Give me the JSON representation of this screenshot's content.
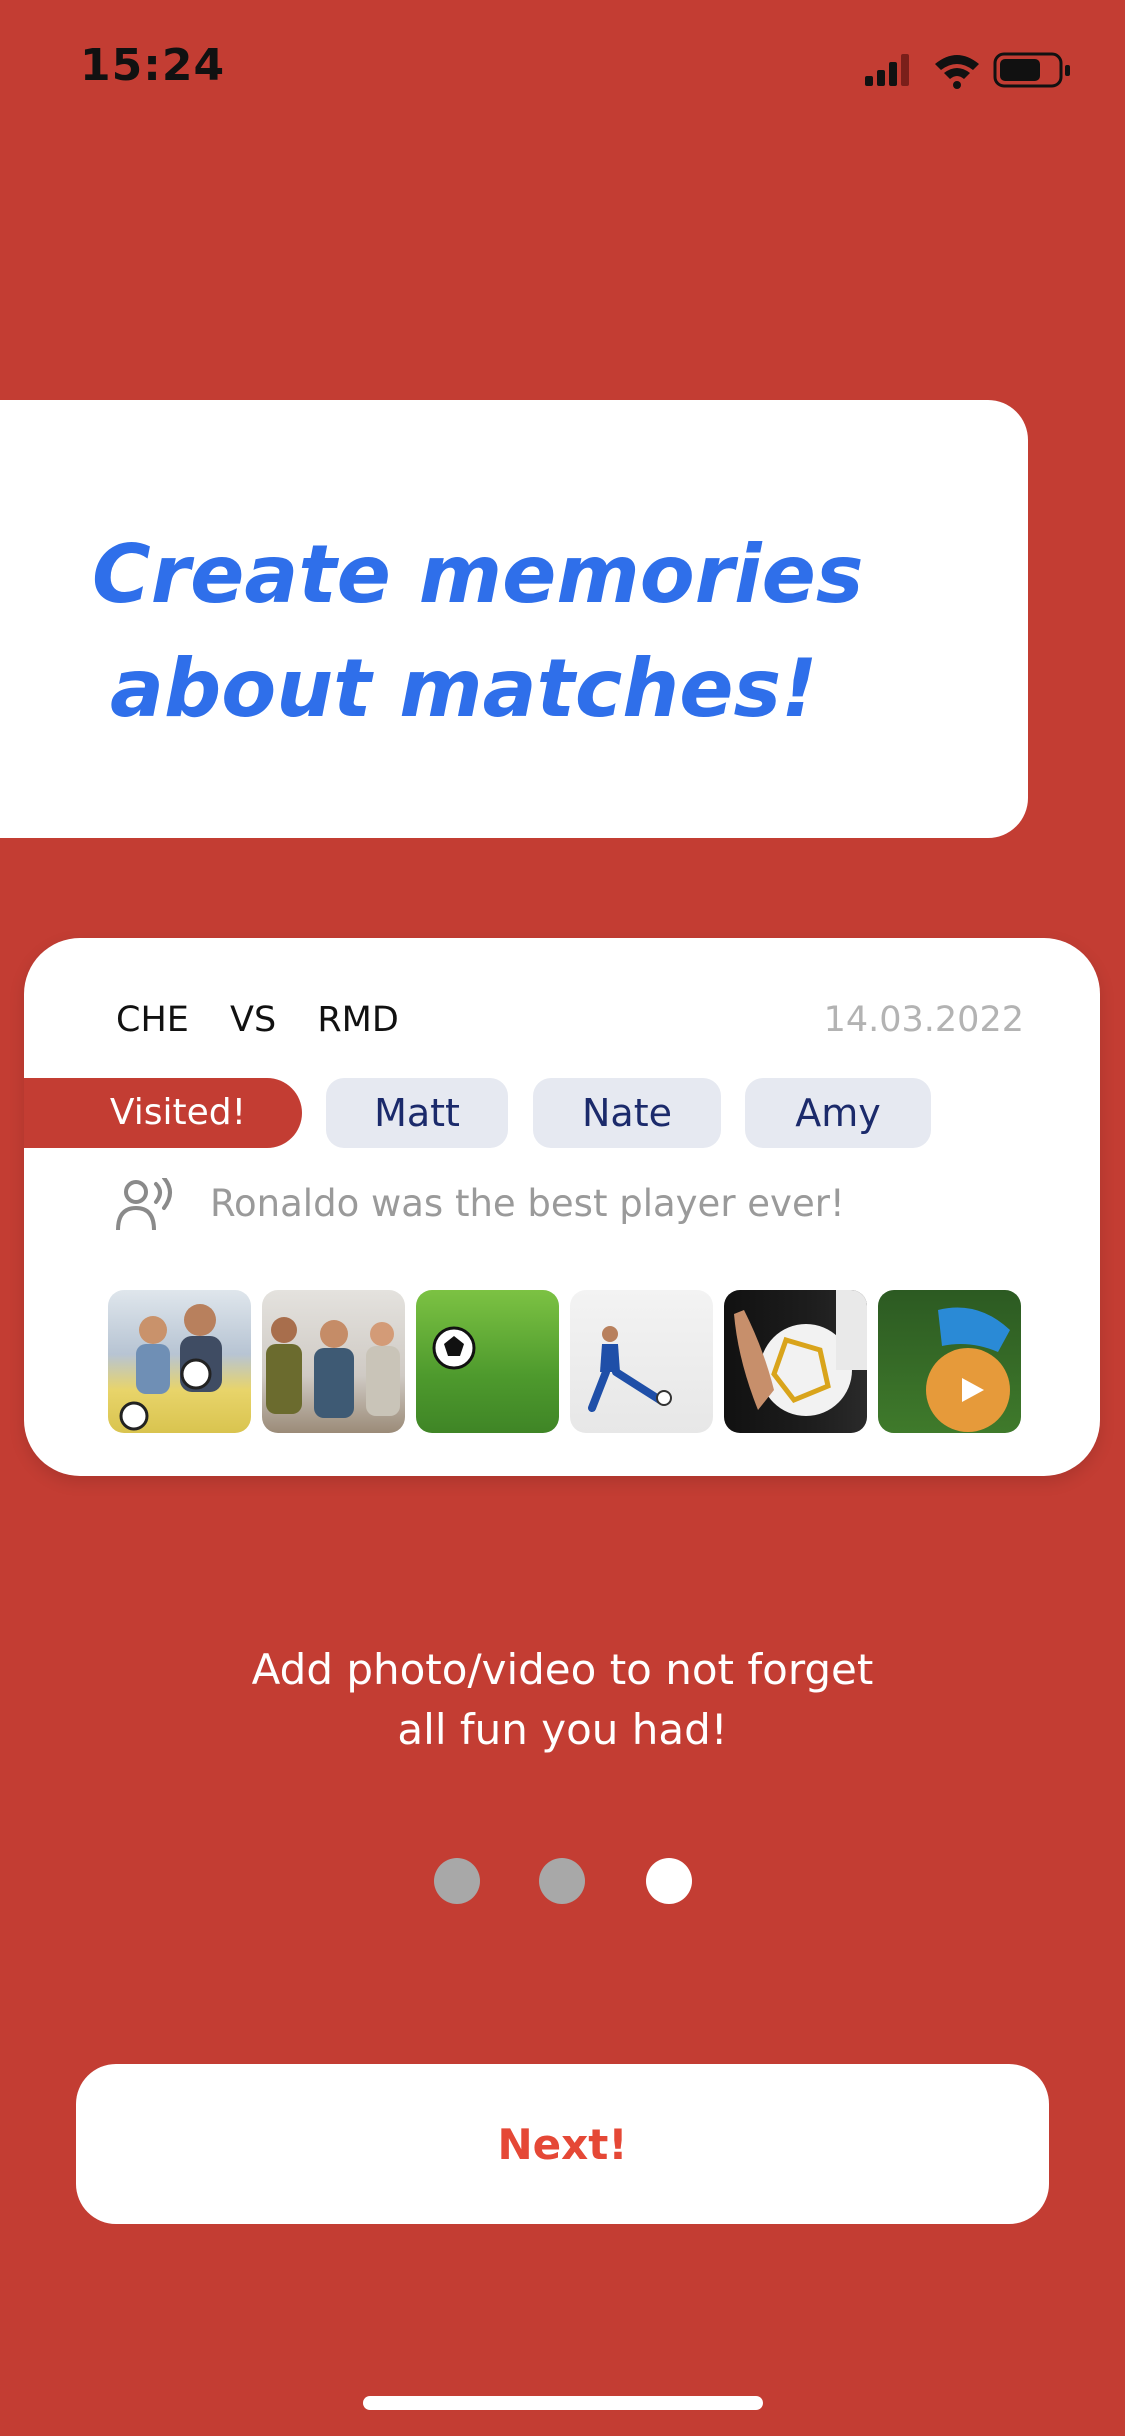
{
  "status_bar": {
    "time": "15:24"
  },
  "headline": {
    "line1": "Create memories",
    "line2": "about matches!"
  },
  "match_card": {
    "team_home": "CHE",
    "versus": "VS",
    "team_away": "RMD",
    "date": "14.03.2022",
    "visited_label": "Visited!",
    "friends": [
      "Matt",
      "Nate",
      "Amy"
    ],
    "comment": "Ronaldo was the best player ever!",
    "photos": [
      "fans-on-couch-photo",
      "friends-watching-photo",
      "ball-on-grass-photo",
      "player-kicking-photo",
      "hands-holding-ball-photo",
      "boot-on-ball-video"
    ]
  },
  "caption": {
    "line1": "Add photo/video to not forget",
    "line2": "all fun you had!"
  },
  "pagination": {
    "total": 3,
    "active": 3
  },
  "next_button": {
    "label": "Next!"
  },
  "colors": {
    "background": "#c33d33",
    "headline": "#2f6fea",
    "chip_bg": "#e6e9f1",
    "chip_text": "#1b2a6b",
    "button_text": "#e54836"
  }
}
